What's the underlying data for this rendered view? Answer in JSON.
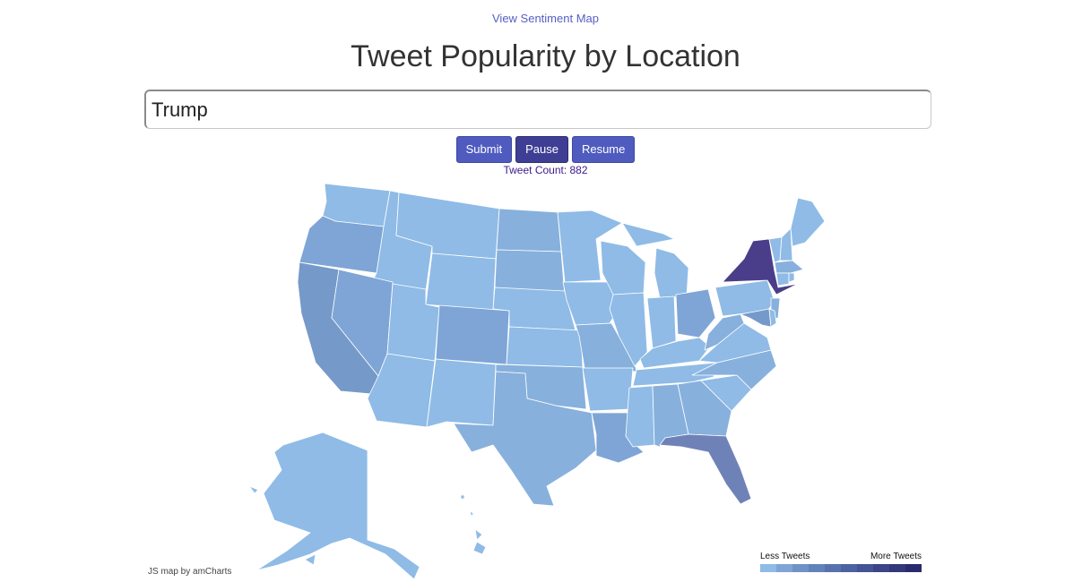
{
  "nav": {
    "sentiment_link": "View Sentiment Map"
  },
  "header": {
    "title": "Tweet Popularity by Location"
  },
  "search": {
    "value": "Trump",
    "placeholder": ""
  },
  "buttons": {
    "submit": "Submit",
    "pause": "Pause",
    "resume": "Resume"
  },
  "status": {
    "tweet_count_label": "Tweet Count: 882"
  },
  "map": {
    "credit": "JS map by amCharts"
  },
  "legend": {
    "less_label": "Less Tweets",
    "more_label": "More Tweets",
    "colors": [
      "#8fbbe6",
      "#7ea5d5",
      "#6f93c7",
      "#6282ba",
      "#5772ad",
      "#4d62a1",
      "#445494",
      "#3b4587",
      "#33387a",
      "#2a2b6d"
    ]
  },
  "colors": {
    "accent": "#4f5bbf",
    "link": "#5560c4",
    "tweet_count": "#3a1a8c",
    "map_base": "#8fbbe6",
    "map_mid": "#7ea5d5",
    "map_high": "#5566a8",
    "map_top": "#4a3d8a"
  }
}
